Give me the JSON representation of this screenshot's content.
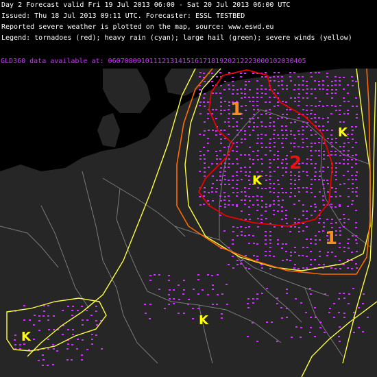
{
  "header": {
    "line1": "Day 2 Forecast valid Fri 19 Jul 2013 06:00 - Sat 20 Jul 2013 06:00 UTC",
    "line2": "Issued: Thu 18 Jul 2013 09:11 UTC. Forecaster: ESSL TESTBED",
    "line3": "Reported severe weather is plotted on the map, source: www.eswd.eu",
    "line4": "Legend: tornadoes (red); heavy rain (cyan); large hail (green); severe winds (yellow)"
  },
  "lightning": {
    "label": "GLD360 data available at:",
    "hours": [
      "06",
      "07",
      "08",
      "09",
      "10",
      "11",
      "12",
      "13",
      "14",
      "15",
      "16",
      "17",
      "18",
      "19",
      "20",
      "21",
      "22",
      "23",
      "00",
      "01",
      "02",
      "03",
      "04",
      "05"
    ]
  },
  "risk_labels": {
    "level1_north": "1",
    "level2": "2",
    "level1_east": "1"
  },
  "colors": {
    "background": "#000000",
    "land": "#262626",
    "borders": "#7a7a7a",
    "tstorm_line": "#ffff44",
    "level1": "#ff6a00",
    "level2": "#ee0000",
    "lightning": "#cc33ff",
    "hail_symbol": "#ffff00"
  },
  "symbols": {
    "hail_icon": "K"
  }
}
